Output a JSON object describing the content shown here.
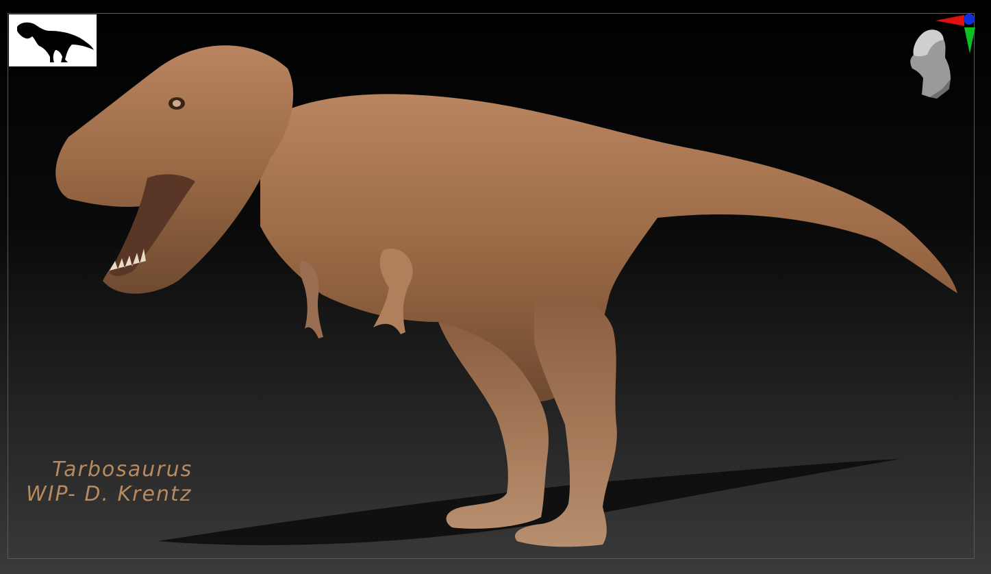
{
  "caption": {
    "line1": "Tarbosaurus",
    "line2": "WIP- D. Krentz"
  },
  "icons": {
    "thumbnail": "dinosaur-silhouette-icon",
    "orientation": "head-orientation-gizmo-icon"
  },
  "colors": {
    "model_skin": "#9b6a46",
    "background_top": "#000000",
    "background_bottom": "#3a3a3a",
    "caption": "#b88a60",
    "axis_x": "#e01010",
    "axis_y": "#10c020",
    "axis_z": "#1030e0"
  }
}
